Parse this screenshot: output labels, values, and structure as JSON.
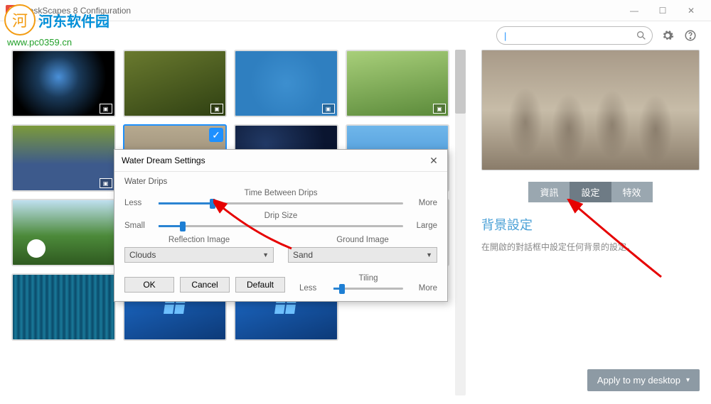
{
  "window": {
    "title": "DeskScapes 8 Configuration",
    "min": "—",
    "max": "☐",
    "close": "✕"
  },
  "watermark": {
    "brand": "河东软件园",
    "url": "www.pc0359.cn"
  },
  "toolbar": {
    "search_placeholder": "",
    "search_value": ""
  },
  "gallery": {
    "items": [
      {
        "style": "th-earth",
        "video": true,
        "selected": false
      },
      {
        "style": "th-grass",
        "video": true,
        "selected": false
      },
      {
        "style": "th-blue",
        "video": true,
        "selected": false
      },
      {
        "style": "th-bug",
        "video": true,
        "selected": false
      },
      {
        "style": "th-car",
        "video": true,
        "selected": false
      },
      {
        "style": "th-sand",
        "video": false,
        "selected": true
      },
      {
        "style": "th-night",
        "video": false,
        "selected": false
      },
      {
        "style": "th-sky",
        "video": false,
        "selected": false
      },
      {
        "style": "th-golf",
        "video": false,
        "selected": false
      },
      {
        "style": "th-solar",
        "video": false,
        "selected": false
      },
      {
        "style": "th-beach",
        "video": false,
        "selected": false
      },
      {
        "style": "th-neon",
        "video": false,
        "selected": false
      },
      {
        "style": "th-wave",
        "video": false,
        "selected": false
      },
      {
        "style": "th-win",
        "video": false,
        "selected": false
      },
      {
        "style": "th-win",
        "video": false,
        "selected": false
      }
    ]
  },
  "preview": {
    "tabs": {
      "info": "資訊",
      "settings": "設定",
      "effects": "特效",
      "active": "settings"
    },
    "section_title": "背景設定",
    "section_desc": "在開啟的對話框中設定任何背景的設定。",
    "apply_label": "Apply to my desktop"
  },
  "modal": {
    "title": "Water Dream Settings",
    "group_label": "Water Drips",
    "slider1": {
      "title": "Time Between Drips",
      "left": "Less",
      "right": "More",
      "value_pct": 22
    },
    "slider2": {
      "title": "Drip Size",
      "left": "Small",
      "right": "Large",
      "value_pct": 10
    },
    "reflection_label": "Reflection Image",
    "reflection_value": "Clouds",
    "ground_label": "Ground Image",
    "ground_value": "Sand",
    "tiling": {
      "title": "Tiling",
      "left": "Less",
      "right": "More",
      "value_pct": 12
    },
    "buttons": {
      "ok": "OK",
      "cancel": "Cancel",
      "default": "Default"
    }
  }
}
